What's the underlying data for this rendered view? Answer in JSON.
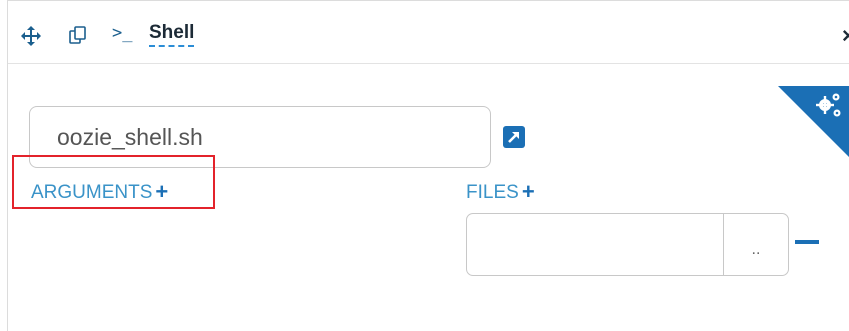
{
  "header": {
    "title": "Shell",
    "prompt_glyph": ">_",
    "close_glyph": "×",
    "icons": [
      "move-icon",
      "copy-icon",
      "shell-prompt-icon",
      "close-icon"
    ]
  },
  "settings": {
    "icon": "gears-icon",
    "color": "#1b6fb5"
  },
  "script": {
    "value": "oozie_shell.sh",
    "link_icon": "external-link-icon"
  },
  "arguments": {
    "label": "ARGUMENTS",
    "add_glyph": "+"
  },
  "files": {
    "label": "FILES",
    "add_glyph": "+",
    "browse_label": "..",
    "value": "",
    "remove_icon": "minus-icon"
  },
  "colors": {
    "accent": "#1b6fb5",
    "link": "#3a93c8",
    "highlight": "#e3232b"
  }
}
